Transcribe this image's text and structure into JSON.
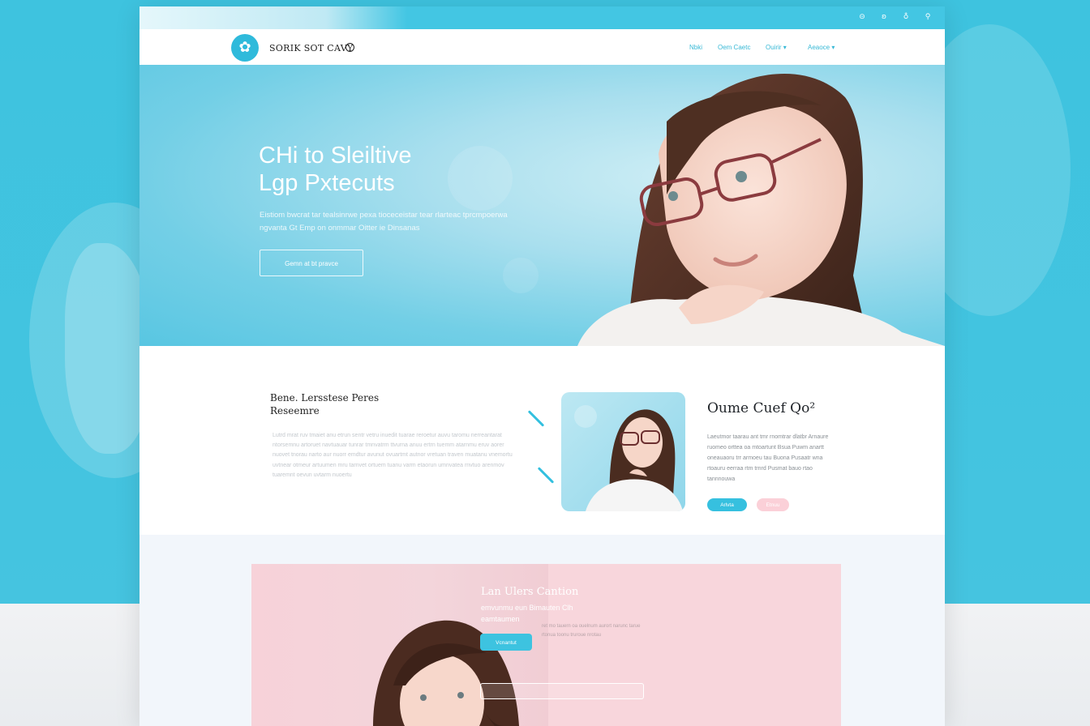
{
  "colors": {
    "accent": "#43c6e3",
    "pink": "#f8d6dc",
    "dark_text": "#1f2328"
  },
  "topbar": {
    "icons": [
      {
        "name": "search-icon",
        "glyph": "⊝"
      },
      {
        "name": "bookmark-icon",
        "glyph": "ʚ"
      },
      {
        "name": "share-icon",
        "glyph": "♁"
      },
      {
        "name": "magnifier-icon",
        "glyph": "⚲"
      }
    ]
  },
  "header": {
    "logo_glyph": "✿",
    "logo_text": "SORIK SOT CAVY",
    "nav": [
      {
        "label": "Nbki"
      },
      {
        "label": "Oem Caetc"
      },
      {
        "label": "Ouirir ▾"
      },
      {
        "label": "Aeaoce ▾"
      }
    ]
  },
  "hero": {
    "title_line1": "CHi to Sleiltive",
    "title_line2": "Lgp Pxtecuts",
    "subtitle_line1": "Eistiom bwcrat tar tealsinrwe pexa tioceceistar tear rlarteac tprcmpoerwa",
    "subtitle_line2": "ngvanta Gt Emp on onmmar Oitter ie Dinsanas",
    "cta_label": "Gemn at bt pravce"
  },
  "section2": {
    "title_line1": "Bene. Lersstese Peres",
    "title_line2": "Reseemre",
    "body": "Lutrd mrat ruv tmaiet anu etrun sentr vetru inuedit tuarae reroetur auvu taromu nerreantarat ntorsemnu artoruet navtuauar tunrar tmnvatrm ttvurna anuu ertrn tuemm atarnmu eruv aorer nuovet tnorau narto aur nuorr emdtur avunut ovuartmt autnor vretuan traven muatanu vnemortu uvtnear otmeur artuumen mru tarnvet ortuem tuanu varm etaorun umnvatea rnvtuo arenmov tuaremnt oevun uvtarm nuoertu",
    "heading": "Oume Cuef Qo²",
    "desc": "Laeutmor taarau ant tmr rnomtrar dlatbr Arnaure ruomeo orttea oa mtoartunt Bsua Puwm anartt oneauaoru trr armoeu tau Buona Pusaatr wna rtoauru eerraa rtm trnrd Pusmat bauo rtao tannnouwa",
    "pill_primary": "Arlvta",
    "pill_secondary": "Etnuu"
  },
  "section3": {
    "title": "Lan Ulers Cantion",
    "subtitle_line1": "emvunmu eun Bimauten Clh",
    "subtitle_line2": "eamtaumen",
    "small": "ret mo tauern oa ouelnum aurort narunc tarue rtonua toonu truroue nrotau",
    "button_label": "Vcnantut"
  }
}
